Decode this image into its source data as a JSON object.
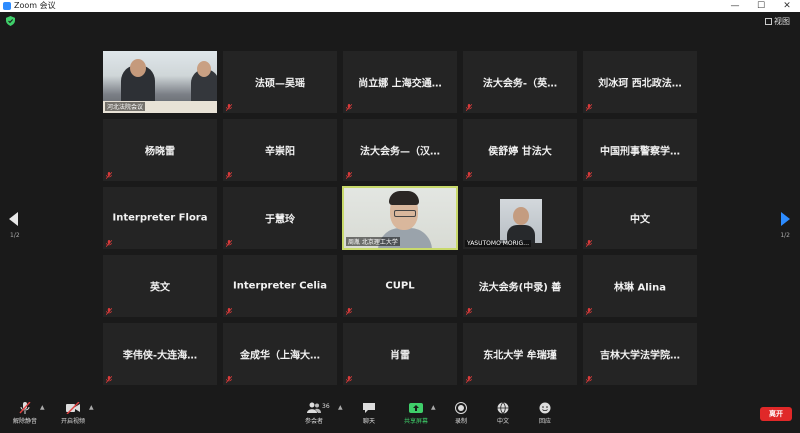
{
  "window": {
    "title": "Zoom 会议",
    "minimize": "—",
    "maximize": "☐",
    "close": "✕"
  },
  "header": {
    "view_label": "视图"
  },
  "colors": {
    "accent": "#2d8cff",
    "active_border": "#c8d96b",
    "mic_muted": "#d93a3a",
    "end": "#e02828",
    "share": "#3fcf6a"
  },
  "gallery": {
    "tiles": [
      {
        "name": "",
        "video_label": "河北法院会议",
        "type": "video1"
      },
      {
        "name": "法硕—吴瑶"
      },
      {
        "name": "尚立娜 上海交通…"
      },
      {
        "name": "法大会务-（英…"
      },
      {
        "name": "刘冰珂 西北政法…"
      },
      {
        "name": "杨晓雷"
      },
      {
        "name": "辛崇阳"
      },
      {
        "name": "法大会务—（汉…"
      },
      {
        "name": "侯舒婷 甘法大"
      },
      {
        "name": "中国刑事警察学…"
      },
      {
        "name": "Interpreter Flora"
      },
      {
        "name": "于慧玲"
      },
      {
        "name": "",
        "video_label": "周胤 北京理工大学",
        "type": "video2",
        "active": true
      },
      {
        "name": "",
        "video_label": "YASUTOMO MORIG…",
        "type": "video3"
      },
      {
        "name": "中文"
      },
      {
        "name": "英文"
      },
      {
        "name": "Interpreter Celia"
      },
      {
        "name": "CUPL"
      },
      {
        "name": "法大会务(中录) 善"
      },
      {
        "name": "林琳 Alina"
      },
      {
        "name": "李伟侠-大连海…"
      },
      {
        "name": "金成华（上海大…"
      },
      {
        "name": "肖雷"
      },
      {
        "name": "东北大学 牟瑞瑾"
      },
      {
        "name": "吉林大学法学院…"
      }
    ],
    "page_left": "1/2",
    "page_right": "1/2"
  },
  "toolbar": {
    "mute": "解除静音",
    "video": "开启视频",
    "participants": "参会者",
    "participants_count": "36",
    "chat": "聊天",
    "share": "共享屏幕",
    "record": "录制",
    "interpret": "中文",
    "reactions": "回应",
    "end": "离开"
  }
}
